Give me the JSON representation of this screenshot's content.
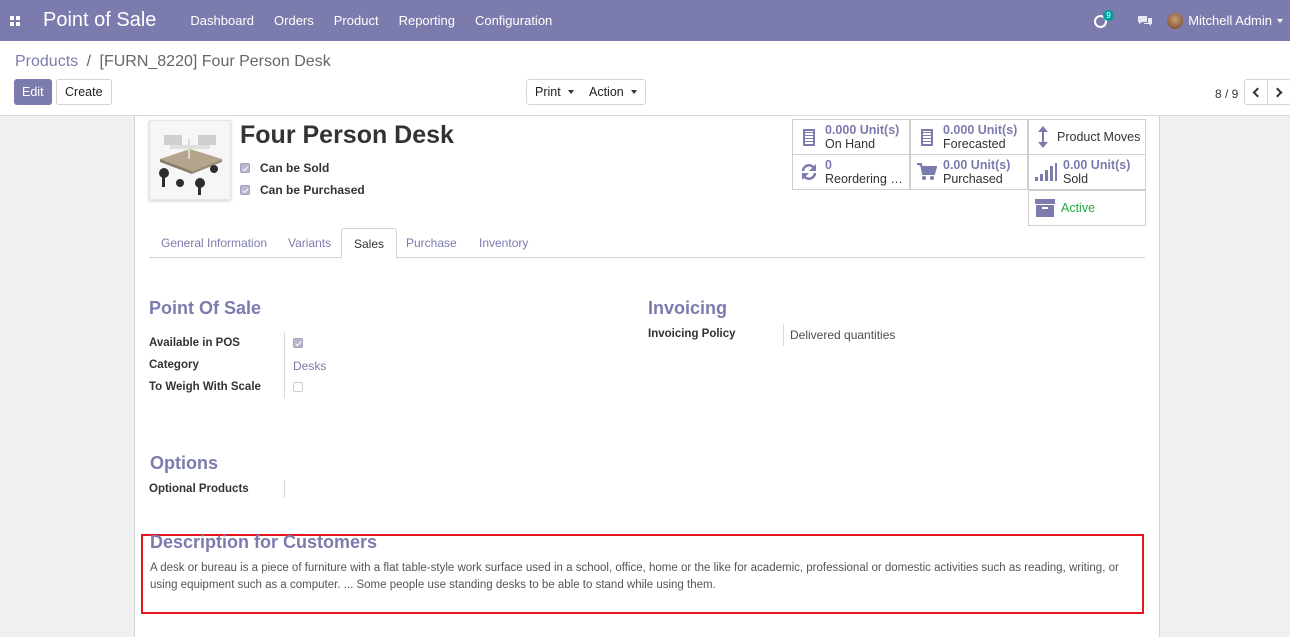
{
  "navbar": {
    "app_name": "Point of Sale",
    "menu": [
      "Dashboard",
      "Orders",
      "Product",
      "Reporting",
      "Configuration"
    ],
    "activity_count": "9",
    "user_name": "Mitchell Admin"
  },
  "breadcrumb": {
    "parent": "Products",
    "separator": "/",
    "current": "[FURN_8220] Four Person Desk"
  },
  "toolbar": {
    "edit_label": "Edit",
    "create_label": "Create",
    "print_label": "Print",
    "action_label": "Action"
  },
  "pager": {
    "value": "8 / 9"
  },
  "product": {
    "name": "Four Person Desk",
    "can_be_sold_label": "Can be Sold",
    "can_be_sold": true,
    "can_be_purchased_label": "Can be Purchased",
    "can_be_purchased": true
  },
  "smart_buttons": {
    "on_hand": {
      "value": "0.000 Unit(s)",
      "label": "On Hand"
    },
    "forecasted": {
      "value": "0.000 Unit(s)",
      "label": "Forecasted"
    },
    "product_moves": {
      "label": "Product Moves"
    },
    "reordering": {
      "value": "0",
      "label": "Reordering R..."
    },
    "purchased": {
      "value": "0.00 Unit(s)",
      "label": "Purchased"
    },
    "sold": {
      "value": "0.00 Unit(s)",
      "label": "Sold"
    },
    "active": {
      "label": "Active"
    }
  },
  "tabs": [
    "General Information",
    "Variants",
    "Sales",
    "Purchase",
    "Inventory"
  ],
  "active_tab": "Sales",
  "pos_section": {
    "title": "Point Of Sale",
    "available_label": "Available in POS",
    "available": true,
    "category_label": "Category",
    "category_value": "Desks",
    "weigh_label": "To Weigh With Scale",
    "weigh": false
  },
  "invoicing_section": {
    "title": "Invoicing",
    "policy_label": "Invoicing Policy",
    "policy_value": "Delivered quantities"
  },
  "options_section": {
    "title": "Options",
    "optional_label": "Optional Products"
  },
  "description_section": {
    "title": "Description for Customers",
    "text": "A desk or bureau is a piece of furniture with a flat table-style work surface used in a school, office, home or the like for academic, professional or domestic activities such as reading, writing, or using equipment such as a computer. ... Some people use standing desks to be able to stand while using them."
  },
  "colors": {
    "brand": "#7c7bad",
    "active_green": "#28a745",
    "highlight_red": "#e5141d"
  },
  "icons": {
    "apps": "apps-grid-icon",
    "activity": "clock-icon",
    "chat": "chat-icon",
    "on_hand": "building-icon",
    "forecasted": "building-icon",
    "product_moves": "vertical-arrows-icon",
    "reordering": "refresh-icon",
    "purchased": "cart-icon",
    "sold": "signal-bars-icon",
    "active": "archive-icon"
  }
}
